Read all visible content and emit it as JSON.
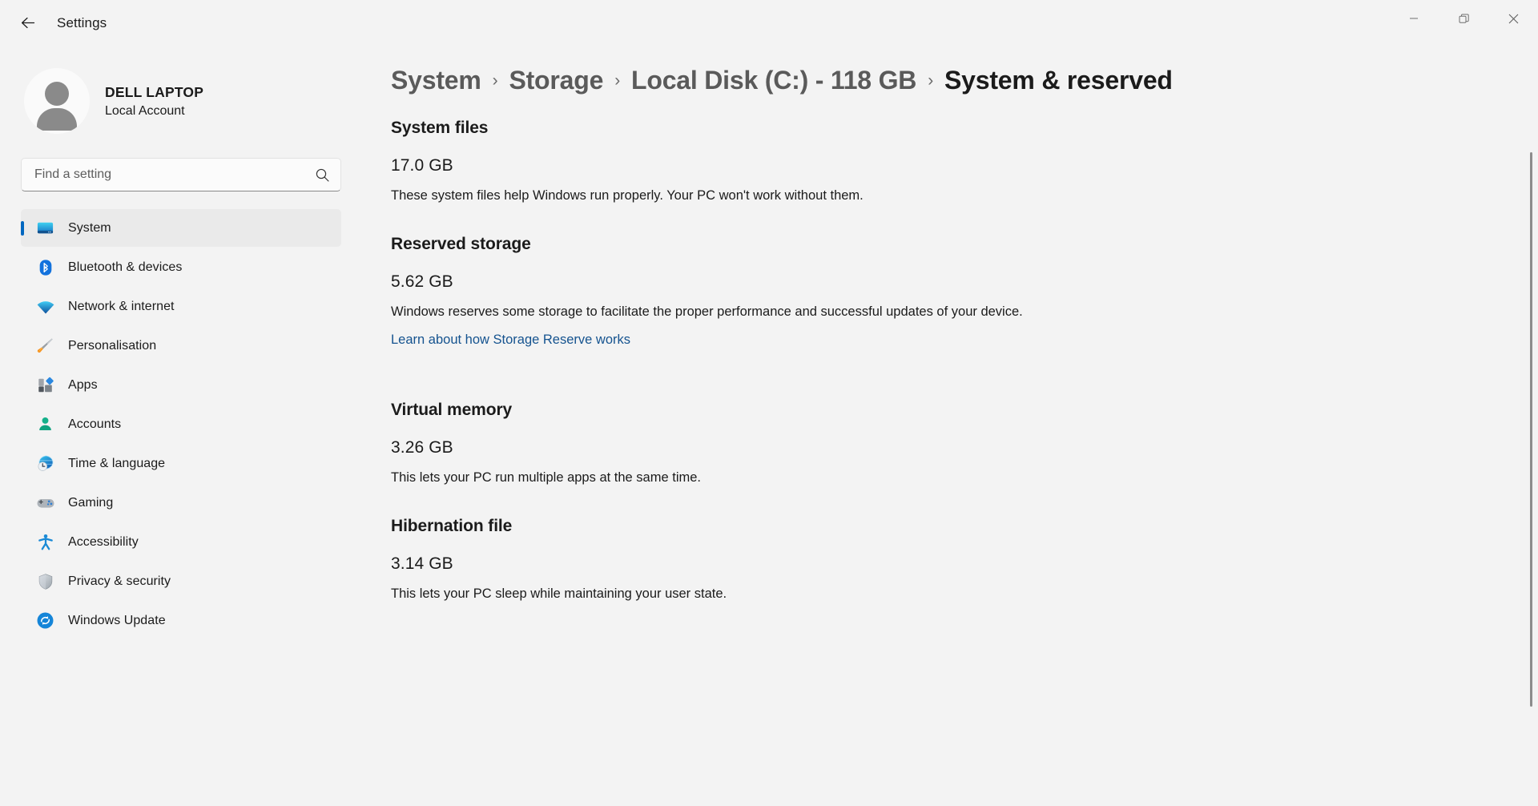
{
  "titlebar": {
    "back_label": "back-arrow",
    "title": "Settings",
    "minimize": "minimize",
    "restore": "restore",
    "close": "close"
  },
  "account": {
    "name": "DELL LAPTOP",
    "type": "Local Account"
  },
  "search": {
    "placeholder": "Find a setting",
    "value": ""
  },
  "sidebar": {
    "items": [
      {
        "label": "System",
        "icon": "monitor-icon",
        "selected": true
      },
      {
        "label": "Bluetooth & devices",
        "icon": "bluetooth-icon",
        "selected": false
      },
      {
        "label": "Network & internet",
        "icon": "wifi-icon",
        "selected": false
      },
      {
        "label": "Personalisation",
        "icon": "paintbrush-icon",
        "selected": false
      },
      {
        "label": "Apps",
        "icon": "apps-icon",
        "selected": false
      },
      {
        "label": "Accounts",
        "icon": "person-icon",
        "selected": false
      },
      {
        "label": "Time & language",
        "icon": "clock-globe-icon",
        "selected": false
      },
      {
        "label": "Gaming",
        "icon": "gamepad-icon",
        "selected": false
      },
      {
        "label": "Accessibility",
        "icon": "accessibility-icon",
        "selected": false
      },
      {
        "label": "Privacy & security",
        "icon": "shield-icon",
        "selected": false
      },
      {
        "label": "Windows Update",
        "icon": "update-icon",
        "selected": false
      }
    ]
  },
  "breadcrumb": {
    "separator": "›",
    "items": [
      {
        "label": "System",
        "current": false
      },
      {
        "label": "Storage",
        "current": false
      },
      {
        "label": "Local Disk (C:) - 118 GB",
        "current": false
      },
      {
        "label": "System & reserved",
        "current": true
      }
    ]
  },
  "main": {
    "sections": [
      {
        "heading": "System files",
        "value": "17.0 GB",
        "description": "These system files help Windows run properly. Your PC won't work without them.",
        "link": null
      },
      {
        "heading": "Reserved storage",
        "value": "5.62 GB",
        "description": "Windows reserves some storage to facilitate the proper performance and successful updates of your device.",
        "link": "Learn about how Storage Reserve works"
      },
      {
        "heading": "Virtual memory",
        "value": "3.26 GB",
        "description": "This lets your PC run multiple apps at the same time.",
        "link": null
      },
      {
        "heading": "Hibernation file",
        "value": "3.14 GB",
        "description": "This lets your PC sleep while maintaining your user state.",
        "link": null
      }
    ]
  },
  "colors": {
    "accent": "#0067c0",
    "link": "#15538f",
    "background": "#f3f3f3",
    "selected_item": "#eaeaea"
  }
}
